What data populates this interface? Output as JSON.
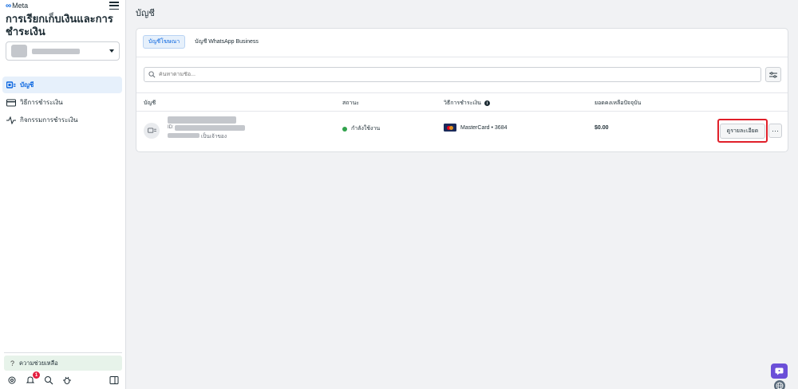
{
  "brand": {
    "logo": "∞",
    "name": "Meta"
  },
  "sidebar": {
    "title": "การเรียกเก็บเงินและการชำระเงิน",
    "items": [
      {
        "label": "บัญชี",
        "icon": "accounts-icon",
        "active": true
      },
      {
        "label": "วิธีการชำระเงิน",
        "icon": "credit-card-icon",
        "active": false
      },
      {
        "label": "กิจกรรมการชำระเงิน",
        "icon": "activity-icon",
        "active": false
      }
    ],
    "help_label": "ความช่วยเหลือ",
    "notification_count": "1"
  },
  "page": {
    "title": "บัญชี",
    "tabs": [
      {
        "label": "บัญชีโฆษณา",
        "active": true
      },
      {
        "label": "บัญชี WhatsApp Business",
        "active": false
      }
    ],
    "search_placeholder": "ค้นหาตามชื่อ...",
    "columns": {
      "account": "บัญชี",
      "status": "สถานะ",
      "payment_method": "วิธีการชำระเงิน",
      "balance": "ยอดคงเหลือปัจจุบัน"
    },
    "rows": [
      {
        "id_prefix": "ID:",
        "owner_suffix": "เป็นเจ้าของ",
        "status": "กำลังใช้งาน",
        "payment": "MasterCard • 3684",
        "balance": "$0.00",
        "details_label": "ดูรายละเอียด",
        "more_label": "···"
      }
    ]
  },
  "colors": {
    "accent": "#0a66e0",
    "status_active": "#31a24c",
    "highlight": "#e0202a",
    "chat_fab": "#6b4fd8"
  }
}
